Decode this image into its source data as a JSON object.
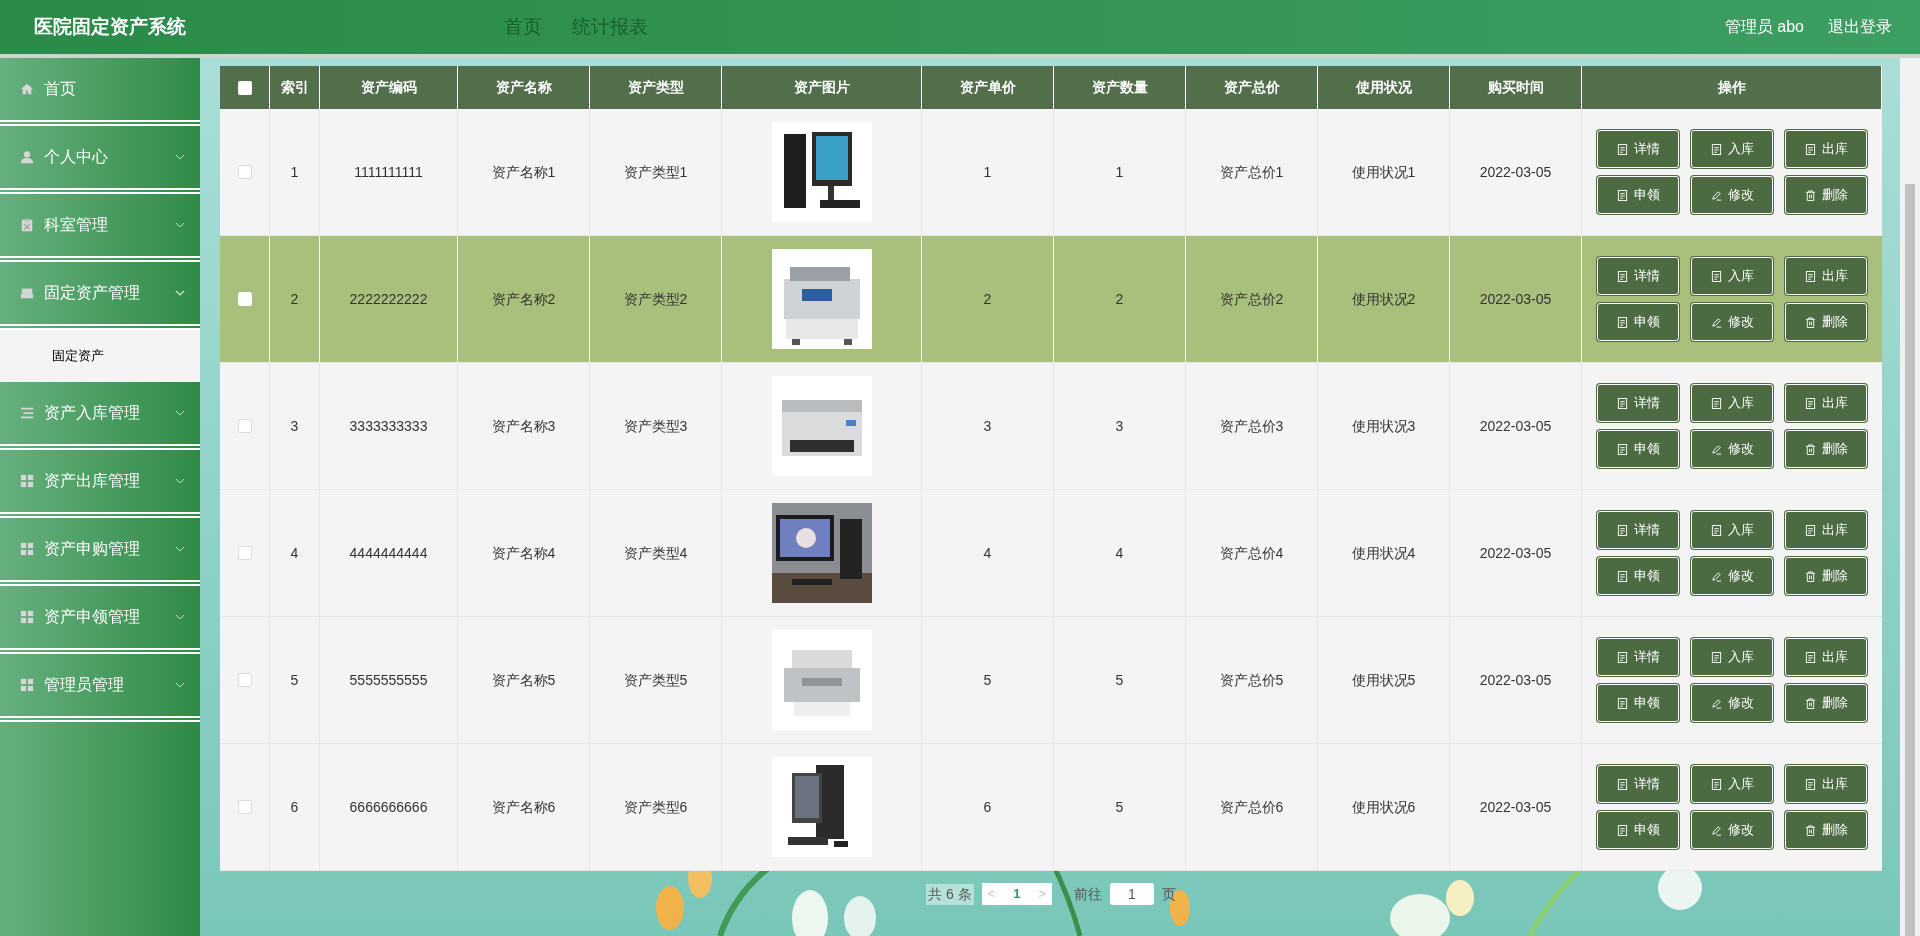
{
  "header": {
    "title": "医院固定资产系统",
    "nav": [
      "首页",
      "统计报表"
    ],
    "user": "管理员 abo",
    "logout": "退出登录"
  },
  "sidebar": {
    "items": [
      {
        "label": "首页"
      },
      {
        "label": "个人中心",
        "expanded": false
      },
      {
        "label": "科室管理",
        "expanded": false
      },
      {
        "label": "固定资产管理",
        "expanded": true,
        "children": [
          {
            "label": "固定资产"
          }
        ]
      },
      {
        "label": "资产入库管理",
        "expanded": false
      },
      {
        "label": "资产出库管理",
        "expanded": false
      },
      {
        "label": "资产申购管理",
        "expanded": false
      },
      {
        "label": "资产申领管理",
        "expanded": false
      },
      {
        "label": "管理员管理",
        "expanded": false
      }
    ]
  },
  "table": {
    "columns": [
      "索引",
      "资产编码",
      "资产名称",
      "资产类型",
      "资产图片",
      "资产单价",
      "资产数量",
      "资产总价",
      "使用状况",
      "购买时间",
      "操作"
    ],
    "header_checked": false,
    "rows": [
      {
        "checked": false,
        "highlighted": false,
        "cells": [
          "1",
          "1111111111",
          "资产名称1",
          "资产类型1",
          "",
          "1",
          "1",
          "资产总价1",
          "使用状况1",
          "2022-03-05"
        ],
        "actions": [
          "详情",
          "入库",
          "出库",
          "申领",
          "修改",
          "删除"
        ]
      },
      {
        "checked": false,
        "highlighted": true,
        "cells": [
          "2",
          "2222222222",
          "资产名称2",
          "资产类型2",
          "",
          "2",
          "2",
          "资产总价2",
          "使用状况2",
          "2022-03-05"
        ],
        "actions": [
          "详情",
          "入库",
          "出库",
          "申领",
          "修改",
          "删除"
        ]
      },
      {
        "checked": false,
        "highlighted": false,
        "cells": [
          "3",
          "3333333333",
          "资产名称3",
          "资产类型3",
          "",
          "3",
          "3",
          "资产总价3",
          "使用状况3",
          "2022-03-05"
        ],
        "actions": [
          "详情",
          "入库",
          "出库",
          "申领",
          "修改",
          "删除"
        ]
      },
      {
        "checked": false,
        "highlighted": false,
        "cells": [
          "4",
          "4444444444",
          "资产名称4",
          "资产类型4",
          "",
          "4",
          "4",
          "资产总价4",
          "使用状况4",
          "2022-03-05"
        ],
        "actions": [
          "详情",
          "入库",
          "出库",
          "申领",
          "修改",
          "删除"
        ]
      },
      {
        "checked": false,
        "highlighted": false,
        "cells": [
          "5",
          "5555555555",
          "资产名称5",
          "资产类型5",
          "",
          "5",
          "5",
          "资产总价5",
          "使用状况5",
          "2022-03-05"
        ],
        "actions": [
          "详情",
          "入库",
          "出库",
          "申领",
          "修改",
          "删除"
        ]
      },
      {
        "checked": false,
        "highlighted": false,
        "cells": [
          "6",
          "6666666666",
          "资产名称6",
          "资产类型6",
          "",
          "6",
          "5",
          "资产总价6",
          "使用状况6",
          "2022-03-05"
        ],
        "actions": [
          "详情",
          "入库",
          "出库",
          "申领",
          "修改",
          "删除"
        ]
      }
    ]
  },
  "pagination": {
    "total": "共 6 条",
    "prev": "<",
    "pages": [
      {
        "label": "1",
        "selected": true
      }
    ],
    "next": ">",
    "goto": "前往",
    "page_input": "1",
    "page_unit": "页"
  }
}
